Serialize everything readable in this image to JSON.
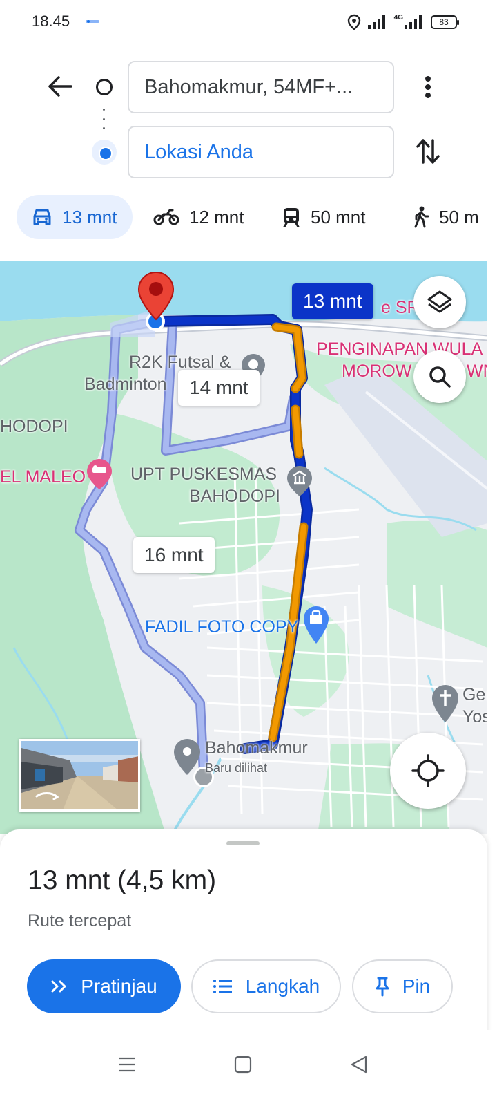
{
  "status_bar": {
    "time": "18.45",
    "network_label": "4G",
    "battery": "83"
  },
  "directions": {
    "origin": "Bahomakmur, 54MF+...",
    "destination": "Lokasi Anda"
  },
  "modes": [
    {
      "name": "car",
      "label": "13 mnt",
      "active": true
    },
    {
      "name": "motorcycle",
      "label": "12 mnt",
      "active": false
    },
    {
      "name": "transit",
      "label": "50 mnt",
      "active": false
    },
    {
      "name": "walk",
      "label": "50 m",
      "active": false
    }
  ],
  "map": {
    "route_chips": {
      "primary": "13 mnt",
      "alt1": "14 mnt",
      "alt2": "16 mnt"
    },
    "labels": {
      "r2k": "R2K Futsal &",
      "badminton": "Badminton",
      "hodopi": "HODOPI",
      "maleo": "EL MALEO",
      "upt1": "UPT PUSKESMAS",
      "upt2": "BAHODOPI",
      "penginapan1": "PENGINAPAN WULA",
      "penginapan2": "MOROW",
      "penginapan2b": "WN",
      "sr": "e SR",
      "fadil": "FADIL FOTO COPY",
      "ger1": "Ger",
      "ger2": "Yos",
      "bahomakmur": "Bahomakmur",
      "baru_dilihat": "Baru dilihat"
    }
  },
  "sheet": {
    "title": "13 mnt (4,5 km)",
    "subtitle": "Rute tercepat",
    "buttons": {
      "preview": "Pratinjau",
      "steps": "Langkah",
      "pin": "Pin"
    }
  },
  "colors": {
    "accent": "#1a73e8",
    "route_primary": "#0b34c8",
    "route_alt": "#a8b8f0",
    "traffic_orange": "#f29900",
    "destination_pin": "#ea4335"
  }
}
